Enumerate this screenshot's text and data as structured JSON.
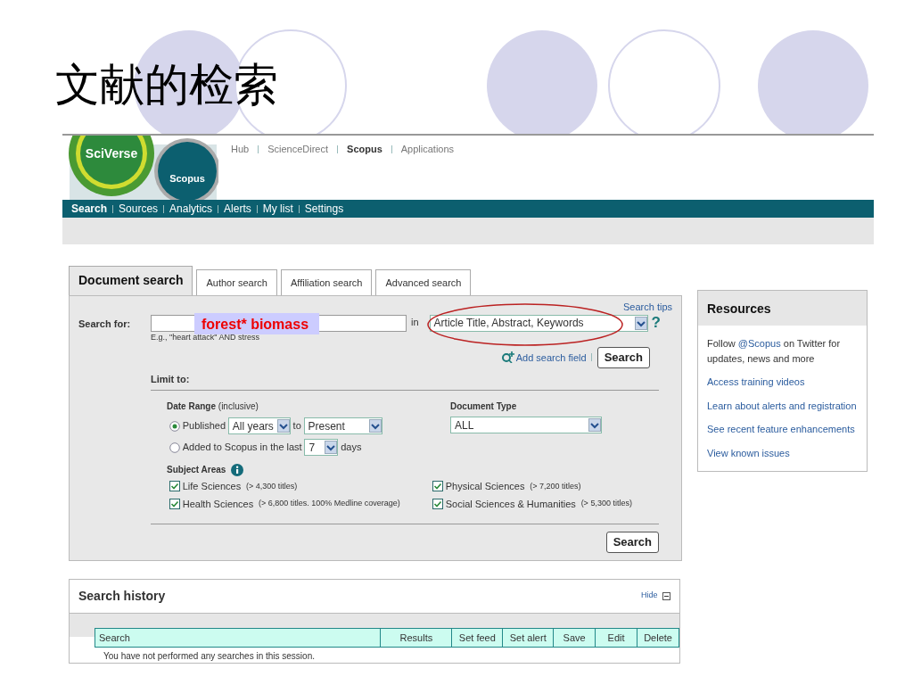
{
  "slide_title": "文献的检索",
  "logo": {
    "brand": "SciVerse",
    "product": "Scopus"
  },
  "site_links": [
    {
      "label": "Hub",
      "selected": false
    },
    {
      "label": "ScienceDirect",
      "selected": false
    },
    {
      "label": "Scopus",
      "selected": true
    },
    {
      "label": "Applications",
      "selected": false
    }
  ],
  "main_nav": [
    {
      "label": "Search",
      "selected": true
    },
    {
      "label": "Sources",
      "selected": false
    },
    {
      "label": "Analytics",
      "selected": false
    },
    {
      "label": "Alerts",
      "selected": false
    },
    {
      "label": "My list",
      "selected": false
    },
    {
      "label": "Settings",
      "selected": false
    }
  ],
  "search_tabs": [
    {
      "label": "Document search",
      "selected": true
    },
    {
      "label": "Author search",
      "selected": false
    },
    {
      "label": "Affiliation search",
      "selected": false
    },
    {
      "label": "Advanced search",
      "selected": false
    }
  ],
  "search_form": {
    "search_tips": "Search tips",
    "search_for_label": "Search for:",
    "hint": "E.g., \"heart attack\" AND stress",
    "annotation": "forest* biomass",
    "in_label": "in",
    "field_select": "Article Title, Abstract, Keywords",
    "help": "?",
    "add_search_field": "Add search field",
    "search_button": "Search"
  },
  "limit": {
    "label": "Limit to:",
    "date_range_label": "Date Range",
    "date_range_note": "(inclusive)",
    "date_options": [
      {
        "kind": "published",
        "label": "Published",
        "selected": true,
        "from": "All years",
        "to_label": "to",
        "to": "Present"
      },
      {
        "kind": "added",
        "label": "Added to Scopus in the last",
        "selected": false,
        "value": "7",
        "suffix": "days"
      }
    ],
    "document_type_label": "Document Type",
    "document_type": "ALL",
    "subject_areas_label": "Subject Areas",
    "subject_areas": [
      {
        "label": "Life Sciences",
        "note": "(> 4,300 titles)",
        "checked": true
      },
      {
        "label": "Physical Sciences",
        "note": "(> 7,200 titles)",
        "checked": true
      },
      {
        "label": "Health Sciences",
        "note": "(> 6,800 titles. 100% Medline coverage)",
        "checked": true
      },
      {
        "label": "Social Sciences & Humanities",
        "note": "(> 5,300 titles)",
        "checked": true
      }
    ],
    "search_button": "Search"
  },
  "resources": {
    "title": "Resources",
    "follow_prefix": "Follow",
    "follow_link": "@Scopus",
    "follow_suffix": "on Twitter for updates, news and more",
    "links": [
      "Access training videos",
      "Learn about alerts and registration",
      "See recent feature enhancements",
      "View known issues"
    ]
  },
  "search_history": {
    "title": "Search history",
    "hide": "Hide",
    "columns": [
      "Search",
      "Results",
      "Set feed",
      "Set alert",
      "Save",
      "Edit",
      "Delete"
    ],
    "empty_message": "You have not performed any searches in this session."
  }
}
